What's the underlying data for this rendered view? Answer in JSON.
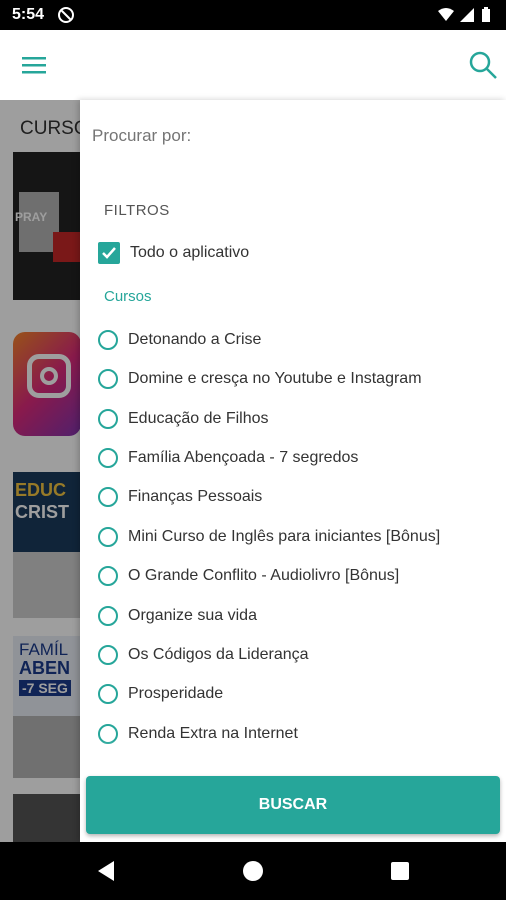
{
  "status_bar": {
    "time": "5:54"
  },
  "app_bar": {
    "menu_icon": "menu-icon",
    "search_icon": "search-icon"
  },
  "background": {
    "section_title": "CURSO",
    "thumb_texts": [
      "PRAY",
      "EDUC",
      "CRIST",
      "FAMÍL",
      "ABEN",
      "-7 SEG"
    ]
  },
  "drawer": {
    "search_placeholder": "Procurar por:",
    "filters_label": "FILTROS",
    "all_app": {
      "label": "Todo o aplicativo",
      "checked": true
    },
    "courses_label": "Cursos",
    "courses": [
      "Detonando a Crise",
      "Domine e cresça no Youtube e Instagram",
      "Educação de Filhos",
      "Família Abençoada - 7 segredos",
      "Finanças Pessoais",
      "Mini Curso de Inglês para iniciantes [Bônus]",
      "O Grande Conflito - Audiolivro [Bônus]",
      "Organize sua vida",
      "Os Códigos da Liderança",
      "Prosperidade",
      "Renda Extra na Internet"
    ],
    "search_button": "BUSCAR"
  },
  "colors": {
    "accent": "#26a69a"
  }
}
